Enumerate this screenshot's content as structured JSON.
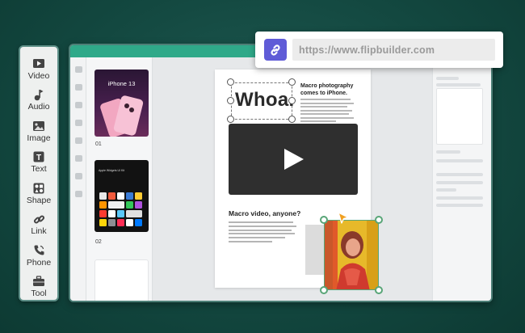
{
  "tools": [
    {
      "label": "Video",
      "icon": "video-icon"
    },
    {
      "label": "Audio",
      "icon": "audio-icon"
    },
    {
      "label": "Image",
      "icon": "image-icon"
    },
    {
      "label": "Text",
      "icon": "text-icon"
    },
    {
      "label": "Shape",
      "icon": "shape-icon"
    },
    {
      "label": "Link",
      "icon": "link-icon"
    },
    {
      "label": "Phone",
      "icon": "phone-icon"
    },
    {
      "label": "Tool",
      "icon": "toolbox-icon"
    }
  ],
  "thumbnails": [
    {
      "number": "01",
      "title": "iPhone 13"
    },
    {
      "number": "02",
      "title": "Apple Widgets UI Kit"
    }
  ],
  "page": {
    "headline": "Whoa.",
    "subheading": "Macro photography comes to iPhone.",
    "section_title": "Macro video, anyone?"
  },
  "url_bar": {
    "url": "https://www.flipbuilder.com",
    "icon": "link-icon"
  },
  "colors": {
    "accent_green": "#2fa989",
    "link_button": "#5f5bd7",
    "background": "#134840"
  }
}
